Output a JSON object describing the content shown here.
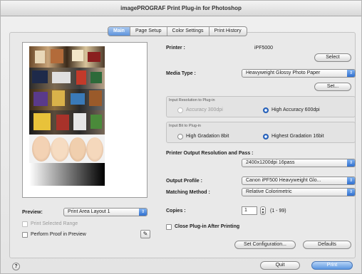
{
  "window": {
    "title": "imagePROGRAF Print Plug-in for Photoshop"
  },
  "tabs": [
    {
      "label": "Main",
      "active": true
    },
    {
      "label": "Page Setup",
      "active": false
    },
    {
      "label": "Color Settings",
      "active": false
    },
    {
      "label": "Print History",
      "active": false
    }
  ],
  "printer": {
    "label": "Printer :",
    "value": "iPF5000",
    "select_label": "Select"
  },
  "media": {
    "label": "Media Type :",
    "value": "Heavyweight Glossy Photo Paper",
    "set_label": "Set..."
  },
  "input_resolution": {
    "title": "Input Resolution to Plug-in",
    "option_a": "Accuracy 300dpi",
    "option_b": "High Accuracy 600dpi",
    "selected": "option_b"
  },
  "input_bit": {
    "title": "Input Bit to Plug-in",
    "option_a": "High Gradation 8bit",
    "option_b": "Highest Gradation 16bit",
    "selected": "option_b"
  },
  "output_resolution": {
    "label": "Printer Output Resolution and Pass :",
    "value": "2400x1200dpi 16pass"
  },
  "output_profile": {
    "label": "Output Profile :",
    "value": "Canon iPF500 Heavyweight Glo..."
  },
  "matching": {
    "label": "Matching Method :",
    "value": "Relative Colorimetric"
  },
  "copies": {
    "label": "Copies :",
    "value": "1",
    "range": "(1 - 99)"
  },
  "close_plugin": {
    "label": "Close Plug-in After Printing",
    "checked": false
  },
  "buttons": {
    "set_configuration": "Set Configuration...",
    "defaults": "Defaults",
    "quit": "Quit",
    "print": "Print"
  },
  "preview": {
    "label": "Preview:",
    "value": "Print Area Layout 1"
  },
  "print_selected_range": {
    "label": "Print Selected Range",
    "enabled": false
  },
  "perform_proof": {
    "label": "Perform Proof in Preview",
    "checked": false
  },
  "icons": {
    "help": "?",
    "arrow": "⇕",
    "stepper_up": "▲",
    "stepper_down": "▼",
    "proof": "✎"
  },
  "colors": {
    "accent": "#4a8ae0",
    "window_bg": "#ececec"
  }
}
